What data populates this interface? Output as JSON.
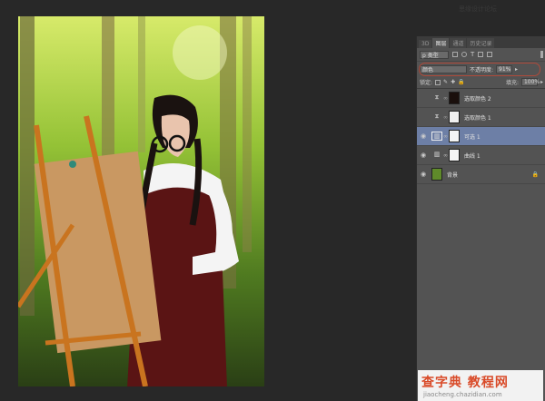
{
  "app": {
    "top_text": "思缘设计论坛"
  },
  "panel": {
    "tabs": [
      "3D",
      "图层",
      "通道",
      "历史记录"
    ],
    "active_tab": 1,
    "kind_filter": "p 类型",
    "blend_mode": "颜色",
    "opacity_label": "不透明度:",
    "opacity_value": "91%",
    "lock_label": "锁定:",
    "fill_label": "填充:",
    "fill_value": "100%"
  },
  "layers": [
    {
      "name": "选取颜色 2",
      "adj_icon": "色阶",
      "thumb": "#1a0f0c",
      "visible": false,
      "selected": false,
      "locked": false
    },
    {
      "name": "选取颜色 1",
      "adj_icon": "色阶",
      "thumb": "#f0f0f0",
      "visible": false,
      "selected": false,
      "locked": false
    },
    {
      "name": "可选 1",
      "adj_icon": "曲线",
      "thumb": "#f4f4f4",
      "visible": true,
      "selected": true,
      "locked": false
    },
    {
      "name": "曲线 1",
      "adj_icon": "曲线",
      "thumb": "#f4f4f4",
      "visible": true,
      "selected": false,
      "locked": false
    },
    {
      "name": "背景",
      "adj_icon": "",
      "thumb": "#5f8a2a",
      "visible": true,
      "selected": false,
      "locked": true
    }
  ],
  "watermark": {
    "title": "查字典 教程网",
    "url": "jiaocheng.chazidian.com"
  },
  "colors": {
    "selected_layer": "#6d7fa6",
    "panel_bg": "#535353",
    "annotation_oval": "#b04a3a"
  }
}
